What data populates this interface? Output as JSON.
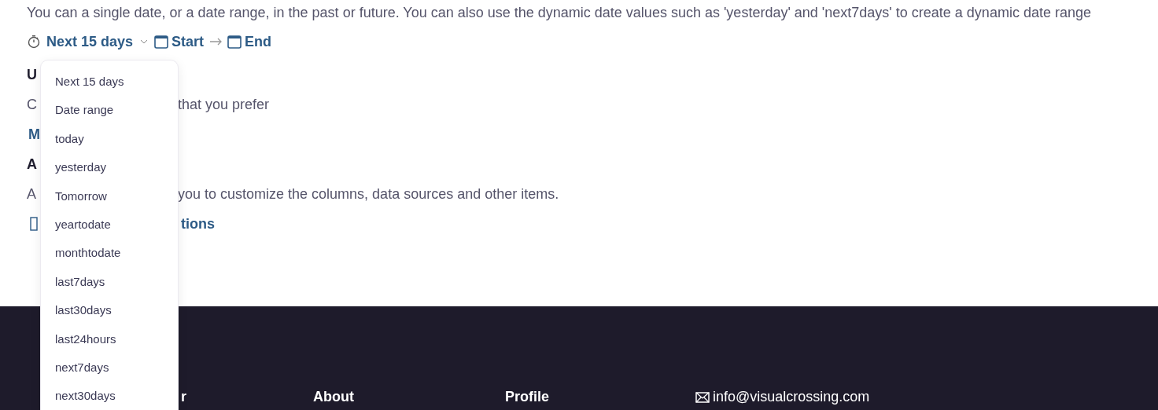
{
  "intro": "You can a single date, or a date range, in the past or future. You can also use the dynamic date values such as 'yesterday' and 'next7days' to create a dynamic date range",
  "date_picker": {
    "preset": "Next 15 days",
    "start": "Start",
    "end": "End",
    "expanded": true
  },
  "dropdown": {
    "options": [
      {
        "label": "Next 15 days",
        "selected": false
      },
      {
        "label": "Date range",
        "selected": false
      },
      {
        "label": "today",
        "selected": false
      },
      {
        "label": "yesterday",
        "selected": false
      },
      {
        "label": "Tomorrow",
        "selected": false
      },
      {
        "label": "yeartodate",
        "selected": false
      },
      {
        "label": "monthtodate",
        "selected": false
      },
      {
        "label": "last7days",
        "selected": false
      },
      {
        "label": "last30days",
        "selected": false
      },
      {
        "label": "last24hours",
        "selected": false
      },
      {
        "label": "next7days",
        "selected": false
      },
      {
        "label": "next30days",
        "selected": false
      }
    ]
  },
  "sections": [
    {
      "heading": "U",
      "text_left": "C",
      "text_right": "that you prefer",
      "control": "M"
    },
    {
      "heading": "A",
      "text_left": "A",
      "text_right": "you to customize the columns, data sources and other items.",
      "link": "tions"
    }
  ],
  "footer": {
    "headings": [
      "r",
      "About",
      "Profile"
    ],
    "email": "info@visualcrossing.com"
  }
}
